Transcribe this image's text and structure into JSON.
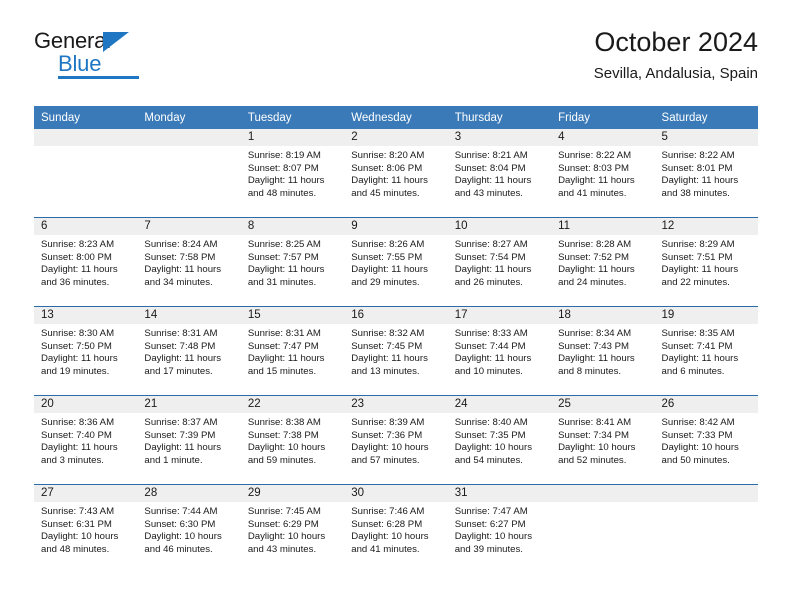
{
  "brand": {
    "name_top": "General",
    "name_bottom": "Blue",
    "mark": "triangle-icon",
    "accent_color": "#1f77c4"
  },
  "header": {
    "title": "October 2024",
    "subtitle": "Sevilla, Andalusia, Spain"
  },
  "theme": {
    "header_blue": "#3b7ab8",
    "row_divider_blue": "#2b6ca8",
    "daynum_band_gray": "#efefef"
  },
  "weekdays": [
    "Sunday",
    "Monday",
    "Tuesday",
    "Wednesday",
    "Thursday",
    "Friday",
    "Saturday"
  ],
  "labels": {
    "sunrise": "Sunrise:",
    "sunset": "Sunset:",
    "daylight": "Daylight:"
  },
  "weeks": [
    [
      {
        "day": "",
        "empty": true
      },
      {
        "day": "",
        "empty": true
      },
      {
        "day": "1",
        "sunrise": "Sunrise: 8:19 AM",
        "sunset": "Sunset: 8:07 PM",
        "daylight1": "Daylight: 11 hours",
        "daylight2": "and 48 minutes."
      },
      {
        "day": "2",
        "sunrise": "Sunrise: 8:20 AM",
        "sunset": "Sunset: 8:06 PM",
        "daylight1": "Daylight: 11 hours",
        "daylight2": "and 45 minutes."
      },
      {
        "day": "3",
        "sunrise": "Sunrise: 8:21 AM",
        "sunset": "Sunset: 8:04 PM",
        "daylight1": "Daylight: 11 hours",
        "daylight2": "and 43 minutes."
      },
      {
        "day": "4",
        "sunrise": "Sunrise: 8:22 AM",
        "sunset": "Sunset: 8:03 PM",
        "daylight1": "Daylight: 11 hours",
        "daylight2": "and 41 minutes."
      },
      {
        "day": "5",
        "sunrise": "Sunrise: 8:22 AM",
        "sunset": "Sunset: 8:01 PM",
        "daylight1": "Daylight: 11 hours",
        "daylight2": "and 38 minutes."
      }
    ],
    [
      {
        "day": "6",
        "sunrise": "Sunrise: 8:23 AM",
        "sunset": "Sunset: 8:00 PM",
        "daylight1": "Daylight: 11 hours",
        "daylight2": "and 36 minutes."
      },
      {
        "day": "7",
        "sunrise": "Sunrise: 8:24 AM",
        "sunset": "Sunset: 7:58 PM",
        "daylight1": "Daylight: 11 hours",
        "daylight2": "and 34 minutes."
      },
      {
        "day": "8",
        "sunrise": "Sunrise: 8:25 AM",
        "sunset": "Sunset: 7:57 PM",
        "daylight1": "Daylight: 11 hours",
        "daylight2": "and 31 minutes."
      },
      {
        "day": "9",
        "sunrise": "Sunrise: 8:26 AM",
        "sunset": "Sunset: 7:55 PM",
        "daylight1": "Daylight: 11 hours",
        "daylight2": "and 29 minutes."
      },
      {
        "day": "10",
        "sunrise": "Sunrise: 8:27 AM",
        "sunset": "Sunset: 7:54 PM",
        "daylight1": "Daylight: 11 hours",
        "daylight2": "and 26 minutes."
      },
      {
        "day": "11",
        "sunrise": "Sunrise: 8:28 AM",
        "sunset": "Sunset: 7:52 PM",
        "daylight1": "Daylight: 11 hours",
        "daylight2": "and 24 minutes."
      },
      {
        "day": "12",
        "sunrise": "Sunrise: 8:29 AM",
        "sunset": "Sunset: 7:51 PM",
        "daylight1": "Daylight: 11 hours",
        "daylight2": "and 22 minutes."
      }
    ],
    [
      {
        "day": "13",
        "sunrise": "Sunrise: 8:30 AM",
        "sunset": "Sunset: 7:50 PM",
        "daylight1": "Daylight: 11 hours",
        "daylight2": "and 19 minutes."
      },
      {
        "day": "14",
        "sunrise": "Sunrise: 8:31 AM",
        "sunset": "Sunset: 7:48 PM",
        "daylight1": "Daylight: 11 hours",
        "daylight2": "and 17 minutes."
      },
      {
        "day": "15",
        "sunrise": "Sunrise: 8:31 AM",
        "sunset": "Sunset: 7:47 PM",
        "daylight1": "Daylight: 11 hours",
        "daylight2": "and 15 minutes."
      },
      {
        "day": "16",
        "sunrise": "Sunrise: 8:32 AM",
        "sunset": "Sunset: 7:45 PM",
        "daylight1": "Daylight: 11 hours",
        "daylight2": "and 13 minutes."
      },
      {
        "day": "17",
        "sunrise": "Sunrise: 8:33 AM",
        "sunset": "Sunset: 7:44 PM",
        "daylight1": "Daylight: 11 hours",
        "daylight2": "and 10 minutes."
      },
      {
        "day": "18",
        "sunrise": "Sunrise: 8:34 AM",
        "sunset": "Sunset: 7:43 PM",
        "daylight1": "Daylight: 11 hours",
        "daylight2": "and 8 minutes."
      },
      {
        "day": "19",
        "sunrise": "Sunrise: 8:35 AM",
        "sunset": "Sunset: 7:41 PM",
        "daylight1": "Daylight: 11 hours",
        "daylight2": "and 6 minutes."
      }
    ],
    [
      {
        "day": "20",
        "sunrise": "Sunrise: 8:36 AM",
        "sunset": "Sunset: 7:40 PM",
        "daylight1": "Daylight: 11 hours",
        "daylight2": "and 3 minutes."
      },
      {
        "day": "21",
        "sunrise": "Sunrise: 8:37 AM",
        "sunset": "Sunset: 7:39 PM",
        "daylight1": "Daylight: 11 hours",
        "daylight2": "and 1 minute."
      },
      {
        "day": "22",
        "sunrise": "Sunrise: 8:38 AM",
        "sunset": "Sunset: 7:38 PM",
        "daylight1": "Daylight: 10 hours",
        "daylight2": "and 59 minutes."
      },
      {
        "day": "23",
        "sunrise": "Sunrise: 8:39 AM",
        "sunset": "Sunset: 7:36 PM",
        "daylight1": "Daylight: 10 hours",
        "daylight2": "and 57 minutes."
      },
      {
        "day": "24",
        "sunrise": "Sunrise: 8:40 AM",
        "sunset": "Sunset: 7:35 PM",
        "daylight1": "Daylight: 10 hours",
        "daylight2": "and 54 minutes."
      },
      {
        "day": "25",
        "sunrise": "Sunrise: 8:41 AM",
        "sunset": "Sunset: 7:34 PM",
        "daylight1": "Daylight: 10 hours",
        "daylight2": "and 52 minutes."
      },
      {
        "day": "26",
        "sunrise": "Sunrise: 8:42 AM",
        "sunset": "Sunset: 7:33 PM",
        "daylight1": "Daylight: 10 hours",
        "daylight2": "and 50 minutes."
      }
    ],
    [
      {
        "day": "27",
        "sunrise": "Sunrise: 7:43 AM",
        "sunset": "Sunset: 6:31 PM",
        "daylight1": "Daylight: 10 hours",
        "daylight2": "and 48 minutes."
      },
      {
        "day": "28",
        "sunrise": "Sunrise: 7:44 AM",
        "sunset": "Sunset: 6:30 PM",
        "daylight1": "Daylight: 10 hours",
        "daylight2": "and 46 minutes."
      },
      {
        "day": "29",
        "sunrise": "Sunrise: 7:45 AM",
        "sunset": "Sunset: 6:29 PM",
        "daylight1": "Daylight: 10 hours",
        "daylight2": "and 43 minutes."
      },
      {
        "day": "30",
        "sunrise": "Sunrise: 7:46 AM",
        "sunset": "Sunset: 6:28 PM",
        "daylight1": "Daylight: 10 hours",
        "daylight2": "and 41 minutes."
      },
      {
        "day": "31",
        "sunrise": "Sunrise: 7:47 AM",
        "sunset": "Sunset: 6:27 PM",
        "daylight1": "Daylight: 10 hours",
        "daylight2": "and 39 minutes."
      },
      {
        "day": "",
        "empty": true
      },
      {
        "day": "",
        "empty": true
      }
    ]
  ]
}
